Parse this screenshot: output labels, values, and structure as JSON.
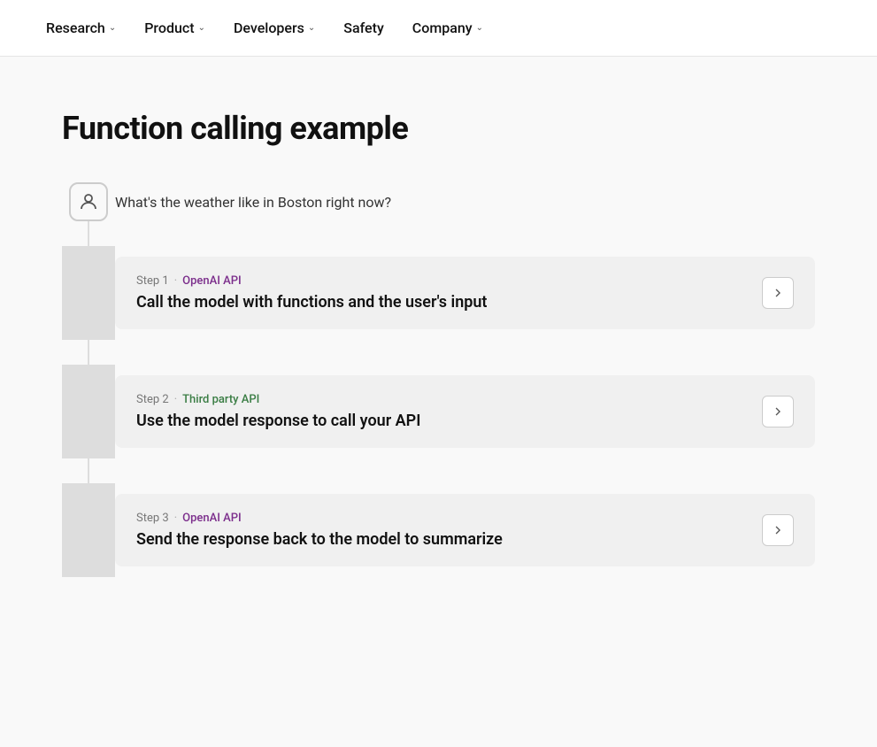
{
  "nav": {
    "items": [
      {
        "label": "Research",
        "hasDropdown": true,
        "id": "research"
      },
      {
        "label": "Product",
        "hasDropdown": true,
        "id": "product"
      },
      {
        "label": "Developers",
        "hasDropdown": true,
        "id": "developers"
      },
      {
        "label": "Safety",
        "hasDropdown": false,
        "id": "safety"
      },
      {
        "label": "Company",
        "hasDropdown": true,
        "id": "company"
      }
    ]
  },
  "page": {
    "title": "Function calling example"
  },
  "user_message": {
    "text": "What's the weather like in Boston right now?"
  },
  "steps": [
    {
      "id": "step1",
      "step_label": "Step 1",
      "dot": "·",
      "api_label": "OpenAI API",
      "api_class": "openai",
      "title": "Call the model with functions and the user's input"
    },
    {
      "id": "step2",
      "step_label": "Step 2",
      "dot": "·",
      "api_label": "Third party API",
      "api_class": "third-party",
      "title": "Use the model response to call your API"
    },
    {
      "id": "step3",
      "step_label": "Step 3",
      "dot": "·",
      "api_label": "OpenAI API",
      "api_class": "openai",
      "title": "Send the response back to the model to summarize"
    }
  ],
  "colors": {
    "openai": "#7b2d8b",
    "third_party": "#3a7d44",
    "line": "#ddd",
    "card_bg": "#f0f0f0"
  },
  "icons": {
    "expand": "▶",
    "chevron_down": "∨",
    "user": "person"
  }
}
